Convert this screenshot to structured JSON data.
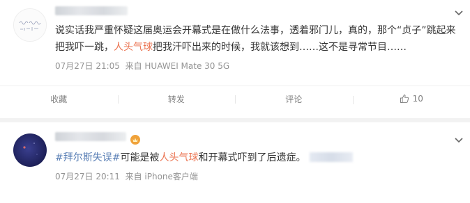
{
  "posts": [
    {
      "content_parts": [
        {
          "text": "说实话我严重怀疑这届奥运会开幕式是在做什么法事，透着邪门儿，真的，那个“贞子”跳起来把我吓一跳，",
          "style": "plain"
        },
        {
          "text": "人头气球",
          "style": "highlight"
        },
        {
          "text": "把我汗吓出来的时候，我就该想到……这不是寻常节目……",
          "style": "plain"
        }
      ],
      "timestamp": "07月27日 21:05",
      "source": "来自 HUAWEI Mate 30 5G",
      "actions": {
        "favorite_label": "收藏",
        "repost_label": "转发",
        "comment_label": "评论",
        "like_count": "10"
      }
    },
    {
      "content_parts": [
        {
          "text": "#拜尔斯失误#",
          "style": "topic"
        },
        {
          "text": "可能是被",
          "style": "plain"
        },
        {
          "text": "人头气球",
          "style": "highlight"
        },
        {
          "text": "和开幕式吓到了后遗症。",
          "style": "plain"
        }
      ],
      "timestamp": "07月27日 20:11",
      "source": "来自 iPhone客户端"
    }
  ],
  "colors": {
    "highlight": "#eb7350",
    "topic": "#5a7fb5",
    "meta": "#939393"
  }
}
